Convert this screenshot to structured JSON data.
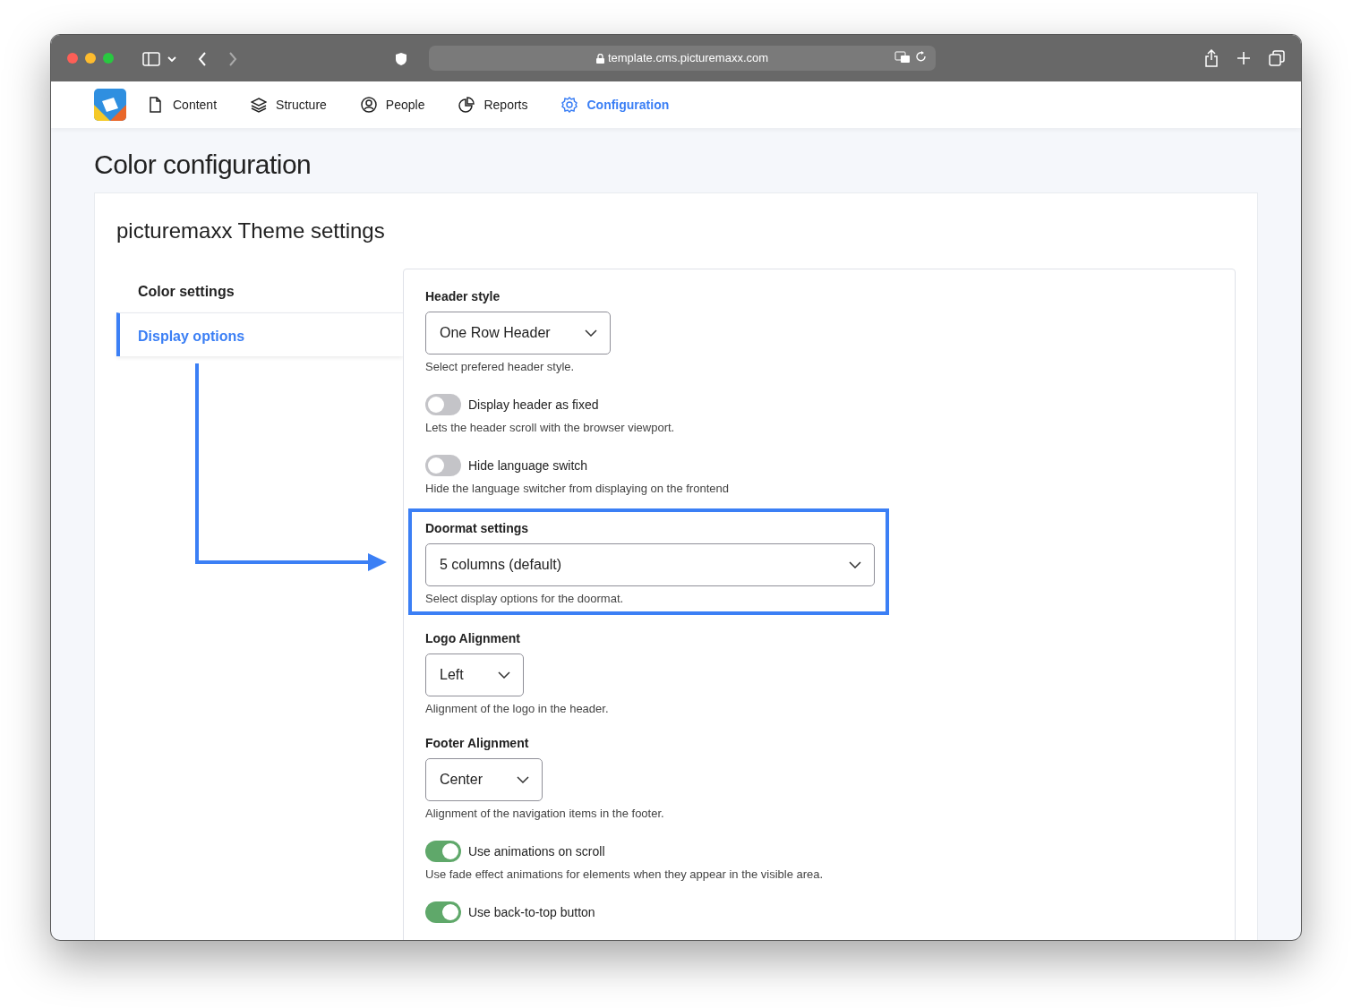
{
  "browser": {
    "url": "template.cms.picturemaxx.com"
  },
  "nav": [
    {
      "label": "Content",
      "selected": false
    },
    {
      "label": "Structure",
      "selected": false
    },
    {
      "label": "People",
      "selected": false
    },
    {
      "label": "Reports",
      "selected": false
    },
    {
      "label": "Configuration",
      "selected": true
    }
  ],
  "page_title": "Color configuration",
  "card_title": "picturemaxx Theme settings",
  "tabs": [
    {
      "label": "Color settings",
      "selected": false
    },
    {
      "label": "Display options",
      "selected": true
    }
  ],
  "fields": [
    {
      "kind": "select",
      "label": "Header style",
      "value": "One Row Header",
      "help": "Select prefered header style.",
      "highlighted": false
    },
    {
      "kind": "toggle",
      "label": "Display header as fixed",
      "on": false,
      "help": "Lets the header scroll with the browser viewport."
    },
    {
      "kind": "toggle",
      "label": "Hide language switch",
      "on": false,
      "help": "Hide the language switcher from displaying on the frontend"
    },
    {
      "kind": "select",
      "label": "Doormat settings",
      "value": "5 columns (default)",
      "help": "Select display options for the doormat.",
      "highlighted": true
    },
    {
      "kind": "select",
      "label": "Logo Alignment",
      "value": "Left",
      "help": "Alignment of the logo in the header.",
      "highlighted": false
    },
    {
      "kind": "select",
      "label": "Footer Alignment",
      "value": "Center",
      "help": "Alignment of the navigation items in the footer.",
      "highlighted": false
    },
    {
      "kind": "toggle",
      "label": "Use animations on scroll",
      "on": true,
      "help": "Use fade effect animations for elements when they appear in the visible area."
    },
    {
      "kind": "toggle",
      "label": "Use back-to-top button",
      "on": true
    }
  ]
}
